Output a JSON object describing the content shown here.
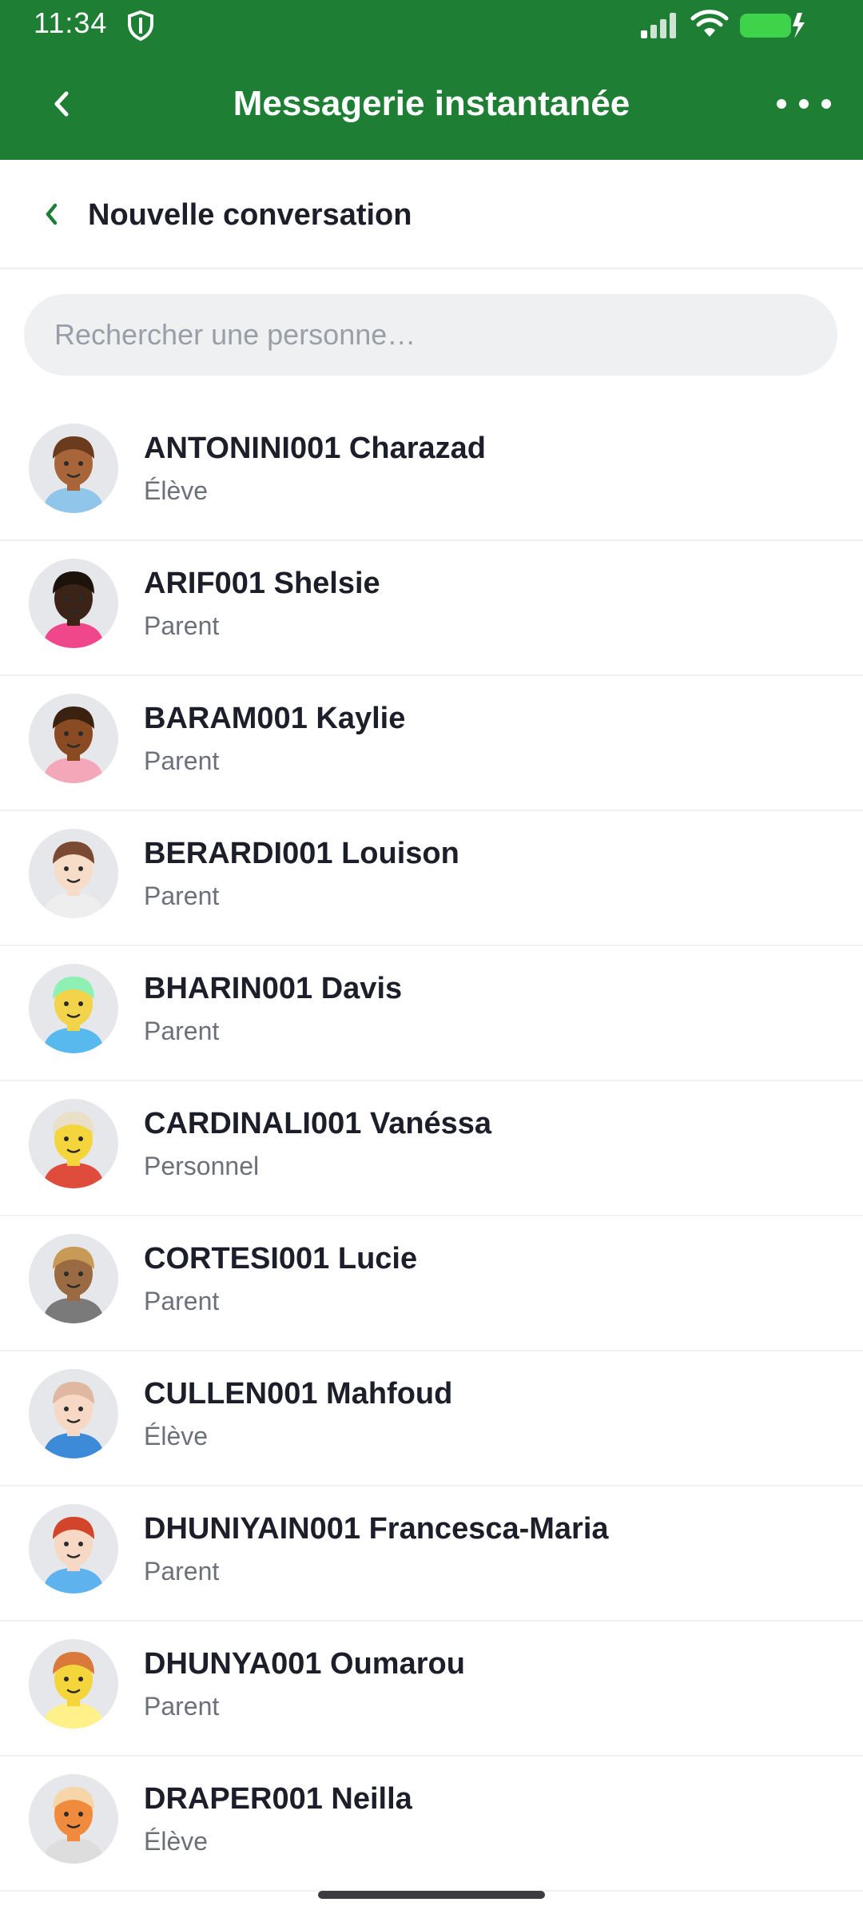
{
  "status_bar": {
    "time": "11:34"
  },
  "header": {
    "title": "Messagerie instantanée"
  },
  "subheader": {
    "title": "Nouvelle conversation"
  },
  "search": {
    "placeholder": "Rechercher une personne…",
    "value": ""
  },
  "colors": {
    "brand_green": "#1e7e34",
    "battery_green": "#3ed34a",
    "text_dark": "#1c1f2a",
    "text_muted": "#6c707a"
  },
  "contacts": [
    {
      "name": "ANTONINI001 Charazad",
      "role": "Élève",
      "skin": "#a8653a",
      "hair": "#6b3b1e",
      "shirt": "#8fc6ea"
    },
    {
      "name": "ARIF001 Shelsie",
      "role": "Parent",
      "skin": "#3b2417",
      "hair": "#1d130d",
      "shirt": "#f0468a"
    },
    {
      "name": "BARAM001 Kaylie",
      "role": "Parent",
      "skin": "#8a4a22",
      "hair": "#3a2110",
      "shirt": "#f4a7b9"
    },
    {
      "name": "BERARDI001 Louison",
      "role": "Parent",
      "skin": "#f7dcc8",
      "hair": "#7a4a34",
      "shirt": "#eeeeee"
    },
    {
      "name": "BHARIN001 Davis",
      "role": "Parent",
      "skin": "#f2d34a",
      "hair": "#8ff0b4",
      "shirt": "#57b9ee"
    },
    {
      "name": "CARDINALI001 Vanéssa",
      "role": "Personnel",
      "skin": "#f4d53c",
      "hair": "#eae0c8",
      "shirt": "#e04c3c"
    },
    {
      "name": "CORTESI001 Lucie",
      "role": "Parent",
      "skin": "#9a6a42",
      "hair": "#c79a55",
      "shirt": "#7a7a7a"
    },
    {
      "name": "CULLEN001 Mahfoud",
      "role": "Élève",
      "skin": "#f6d8c4",
      "hair": "#e0b8a2",
      "shirt": "#3d8ad8"
    },
    {
      "name": "DHUNIYAIN001 Francesca-Maria",
      "role": "Parent",
      "skin": "#f6d8c4",
      "hair": "#d2452a",
      "shirt": "#5eb2ee"
    },
    {
      "name": "DHUNYA001 Oumarou",
      "role": "Parent",
      "skin": "#f4d53c",
      "hair": "#d97a3c",
      "shirt": "#fff08a"
    },
    {
      "name": "DRAPER001 Neilla",
      "role": "Élève",
      "skin": "#f08a3c",
      "hair": "#f6d6a8",
      "shirt": "#dddddd"
    }
  ]
}
